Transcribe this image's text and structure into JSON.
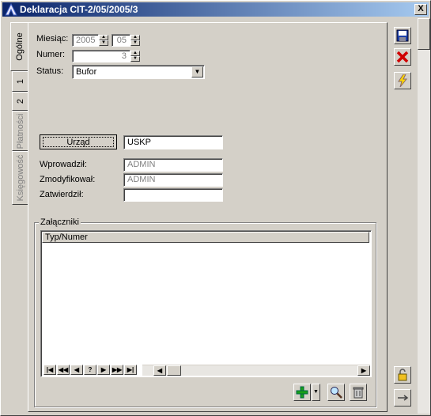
{
  "window": {
    "title": "Deklaracja CIT-2/05/2005/3",
    "close_label": "X"
  },
  "tabs": [
    {
      "label": "Ogólne"
    },
    {
      "label": "1"
    },
    {
      "label": "2"
    },
    {
      "label": "Płatności"
    },
    {
      "label": "Księgowość"
    }
  ],
  "form": {
    "month_label": "Miesiąc:",
    "year_value": "2005",
    "month_value": "05",
    "number_label": "Numer:",
    "number_value": "3",
    "status_label": "Status:",
    "status_value": "Bufor",
    "office_button": "Urząd",
    "office_value": "USKP",
    "entered_label": "Wprowadził:",
    "entered_value": "ADMIN",
    "modified_label": "Zmodyfikował:",
    "modified_value": "ADMIN",
    "approved_label": "Zatwierdził:",
    "approved_value": ""
  },
  "attachments": {
    "group_label": "Załączniki",
    "column_header": "Typ/Numer",
    "nav": [
      "|◀",
      "◀◀",
      "◀",
      "?",
      "▶",
      "▶▶",
      "▶|"
    ]
  },
  "toolbar_icons": [
    "save-icon",
    "delete-icon",
    "run-icon",
    "lock-icon",
    "arrow-icon"
  ],
  "icons_bottom": [
    "add-icon",
    "zoom-icon",
    "trash-icon"
  ]
}
